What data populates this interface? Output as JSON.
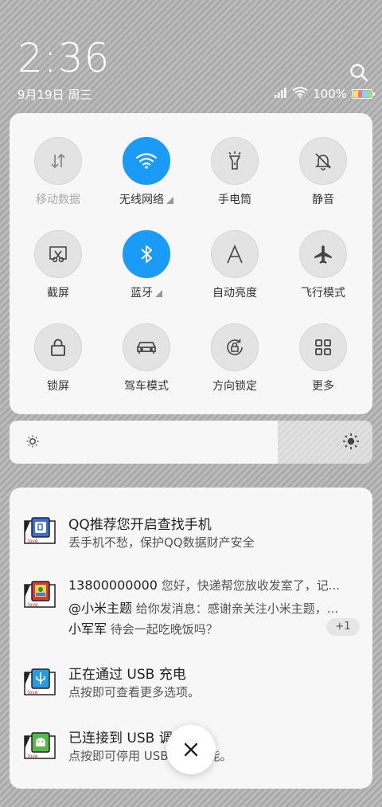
{
  "status": {
    "time": "2:36",
    "date": "9月19日 周三",
    "battery_text": "100%"
  },
  "quick_settings": [
    {
      "label": "移动数据",
      "icon": "mobile-data-icon",
      "active": false,
      "dim": true
    },
    {
      "label": "无线网络",
      "icon": "wifi-icon",
      "active": true,
      "expandable": true
    },
    {
      "label": "手电筒",
      "icon": "flashlight-icon",
      "active": false
    },
    {
      "label": "静音",
      "icon": "mute-bell-icon",
      "active": false
    },
    {
      "label": "截屏",
      "icon": "screenshot-icon",
      "active": false
    },
    {
      "label": "蓝牙",
      "icon": "bluetooth-icon",
      "active": true,
      "expandable": true
    },
    {
      "label": "自动亮度",
      "icon": "auto-brightness-icon",
      "active": false
    },
    {
      "label": "飞行模式",
      "icon": "airplane-icon",
      "active": false
    },
    {
      "label": "锁屏",
      "icon": "lock-icon",
      "active": false
    },
    {
      "label": "驾车模式",
      "icon": "car-icon",
      "active": false
    },
    {
      "label": "方向锁定",
      "icon": "rotation-lock-icon",
      "active": false
    },
    {
      "label": "更多",
      "icon": "grid-icon",
      "active": false
    }
  ],
  "brightness": {
    "level": 0.74
  },
  "notifications": [
    {
      "icon": "qq-security-icon",
      "title": "QQ推荐您开启查找手机",
      "lines": [
        "丢手机不愁，保护QQ数据财产安全"
      ]
    },
    {
      "icon": "qq-message-icon",
      "messages": [
        {
          "sender": "13800000000",
          "text": "您好，快递帮您放收发室了，记..."
        },
        {
          "sender": "@小米主题",
          "text": "给你发消息：感谢亲关注小米主题，..."
        },
        {
          "sender": "小军军",
          "text": "待会一起吃晚饭吗？"
        }
      ],
      "badge": "+1"
    },
    {
      "icon": "usb-icon",
      "title": "正在通过 USB 充电",
      "lines": [
        "点按即可查看更多选项。"
      ]
    },
    {
      "icon": "android-icon",
      "title": "已连接到 USB 调试",
      "lines": [
        "点按即可停用 USB 调试功能。"
      ]
    }
  ],
  "colors": {
    "accent": "#1a9bf7",
    "panel": "#f7f7f7"
  }
}
